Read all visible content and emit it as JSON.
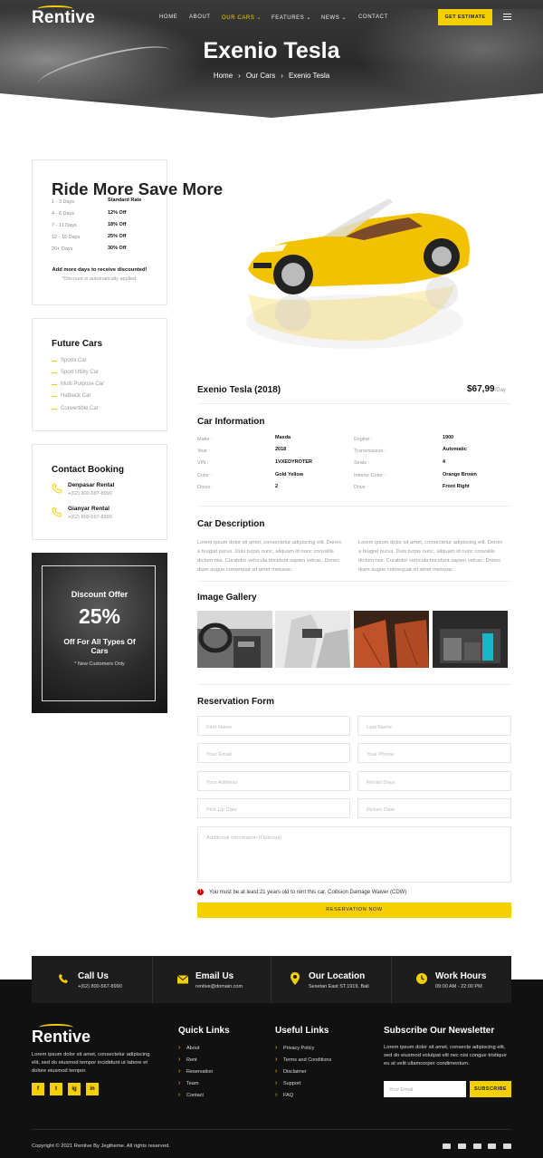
{
  "header": {
    "logo": "Rentive",
    "nav": [
      {
        "label": "HOME",
        "active": false,
        "dropdown": false
      },
      {
        "label": "ABOUT",
        "active": false,
        "dropdown": false
      },
      {
        "label": "OUR CARS",
        "active": true,
        "dropdown": true
      },
      {
        "label": "FEATURES",
        "active": false,
        "dropdown": true
      },
      {
        "label": "NEWS",
        "active": false,
        "dropdown": true
      },
      {
        "label": "CONTACT",
        "active": false,
        "dropdown": false
      }
    ],
    "cta": "GET ESTIMATE",
    "menu_icon": "hamburger-icon"
  },
  "hero": {
    "title": "Exenio Tesla",
    "breadcrumb": [
      "Home",
      "Our Cars",
      "Exenio Tesla"
    ]
  },
  "sidebar": {
    "rates": {
      "title": "Ride More Save More",
      "rows": [
        {
          "days": "1 - 3 Days",
          "value": "Standard Rate"
        },
        {
          "days": "4 - 6 Days",
          "value": "12% Off"
        },
        {
          "days": "7 - 11 Days",
          "value": "18% Off"
        },
        {
          "days": "12 - 16 Days",
          "value": "25% Off"
        },
        {
          "days": "20+ Days",
          "value": "30% Off"
        }
      ],
      "note": "Add more days to receive discounted!",
      "subnote": "*Discount is automatically applied."
    },
    "future": {
      "title": "Future Cars",
      "items": [
        "Sports Car",
        "Sport Utility Car",
        "Multi Purpose Car",
        "Hatback Car",
        "Convertible Car"
      ]
    },
    "booking": {
      "title": "Contact Booking",
      "items": [
        {
          "name": "Denpasar Rental",
          "phone": "+(62) 800-567-8990"
        },
        {
          "name": "Gianyar Rental",
          "phone": "+(62) 800-567-8990"
        }
      ]
    },
    "offer": {
      "title": "Discount Offer",
      "percent": "25%",
      "text": "Off For All Types Of Cars",
      "note": "* New Customers Only"
    }
  },
  "car": {
    "name": "Exenio Tesla (2018)",
    "price": "$67,99",
    "price_unit": "/Day",
    "body_color": "#f2c200"
  },
  "info": {
    "title": "Car Information",
    "left": [
      {
        "label": "Make :",
        "value": "Maxda"
      },
      {
        "label": "Year :",
        "value": "2018"
      },
      {
        "label": "VIN :",
        "value": "1VXEDYROTER"
      },
      {
        "label": "Color :",
        "value": "Gold Yellow"
      },
      {
        "label": "Doors :",
        "value": "2"
      }
    ],
    "right": [
      {
        "label": "Engine :",
        "value": "1900"
      },
      {
        "label": "Transmission :",
        "value": "Automatic"
      },
      {
        "label": "Seats :",
        "value": "4"
      },
      {
        "label": "Interior Color :",
        "value": "Orange Brown"
      },
      {
        "label": "Drive :",
        "value": "Front Right"
      }
    ]
  },
  "description": {
    "title": "Car Description",
    "col1": "Lorem ipsum dolor sit amet, consectetur adipiscing elit. Donec a feugiat purus. Duis turpis nunc, aliquam id nunc convallis dictum nisi. Curabitur vehicula tincidunt sapien velcac. Donec diam augue consequat sit amet metusac.",
    "col2": "Lorem ipsum dolor sit amet, consectetur adipiscing elit. Donec a feugiat purus. Duis turpis nunc, aliquam id nunc convallis dictum nisi. Curabitur vehicula tincidunt sapien velcac. Donec diam augue consequat sit amet metusac."
  },
  "gallery": {
    "title": "Image Gallery",
    "images": [
      "dashboard-photo",
      "seat-photo",
      "leather-interior-photo",
      "trunk-photo"
    ]
  },
  "form": {
    "title": "Reservation Form",
    "fields": [
      "First Name",
      "Last Name",
      "Your Email",
      "Your Phone",
      "Your Address",
      "Rental Days",
      "Pick Up Date",
      "Return Date"
    ],
    "textarea": "Additional Information (Optional)",
    "notice": "You must be at least 21 years old to rent this car. Collision Damage Waiver (CDW)",
    "submit": "RESERVATION NOW"
  },
  "contact_bar": [
    {
      "title": "Call Us",
      "sub": "+(62) 800-567-8990",
      "icon": "phone-icon"
    },
    {
      "title": "Email Us",
      "sub": "rentive@domain.com",
      "icon": "envelope-icon"
    },
    {
      "title": "Our Location",
      "sub": "Sesetan East ST.1919, Bali",
      "icon": "map-pin-icon"
    },
    {
      "title": "Work Hours",
      "sub": "09:00 AM - 22:00 PM",
      "icon": "clock-icon"
    }
  ],
  "footer": {
    "logo": "Rentive",
    "about": "Lorem ipsum dolor sit amet, consectetur adipiscing elit, sed do eiusmod tempor incididunt ut labore et dolore eiusmod tempor.",
    "social": [
      "f",
      "t",
      "ig",
      "in"
    ],
    "quick_links_title": "Quick Links",
    "quick_links": [
      "About",
      "Rent",
      "Reservation",
      "Team",
      "Contact"
    ],
    "useful_links_title": "Useful Links",
    "useful_links": [
      "Privacy Policy",
      "Terms and Conditions",
      "Disclaimer",
      "Support",
      "FAQ"
    ],
    "newsletter_title": "Subscribe Our Newsletter",
    "newsletter_text": "Lorem ipsum dolor sit amet, consecte adipiscing elit, sed do eiusmod volutpat elit nec nisi congue tristique eu at velit ullamcorper condimentum.",
    "email_placeholder": "Your Email",
    "subscribe": "SUBSCRIBE",
    "copyright": "Copyright © 2021 Rentive By Jegtheme. All rights reserved."
  },
  "colors": {
    "accent": "#f5d000",
    "dark": "#111111"
  }
}
